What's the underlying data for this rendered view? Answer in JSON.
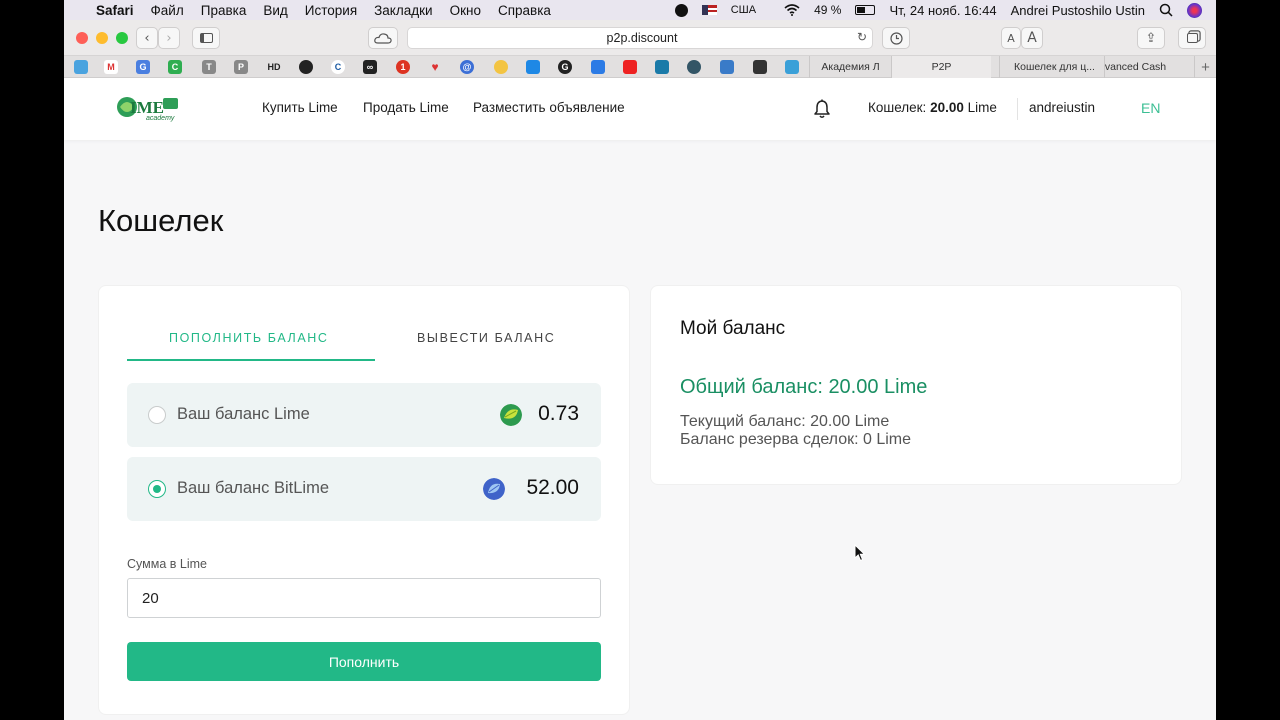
{
  "menubar": {
    "app": "Safari",
    "items": [
      "Файл",
      "Правка",
      "Вид",
      "История",
      "Закладки",
      "Окно",
      "Справка"
    ],
    "keyboard": "США",
    "battery": "49 %",
    "datetime": "Чт, 24 нояб.  16:44",
    "user": "Andrei Pustoshilo Ustin"
  },
  "browser": {
    "url": "p2p.discount",
    "font_small": "A",
    "font_large": "A",
    "tabs": [
      "Академия Л",
      "P2P",
      "Кошелек для ц...",
      "vanced Cash"
    ]
  },
  "header": {
    "nav": [
      "Купить Lime",
      "Продать Lime",
      "Разместить объявление"
    ],
    "wallet_prefix": "Кошелек: ",
    "wallet_amount": "20.00",
    "wallet_suffix": " Lime",
    "username": "andreiustin",
    "lang": "EN"
  },
  "page": {
    "title": "Кошелек"
  },
  "wallet_form": {
    "tab_deposit": "Пополнить баланс",
    "tab_withdraw": "Вывести баланс",
    "options": [
      {
        "label": "Ваш баланс Lime",
        "amount": "0.73",
        "selected": false,
        "icon": "lime-coin-icon"
      },
      {
        "label": "Ваш баланс BitLime",
        "amount": "52.00",
        "selected": true,
        "icon": "bitlime-coin-icon"
      }
    ],
    "amount_label": "Сумма в Lime",
    "amount_value": "20",
    "submit_label": "Пополнить"
  },
  "balance_card": {
    "title": "Мой баланс",
    "total": "Общий баланс: 20.00 Lime",
    "current": "Текущий баланс: 20.00 Lime",
    "reserve": "Баланс резерва сделок: 0 Lime"
  },
  "colors": {
    "accent": "#22b887",
    "accent_dark": "#1a8f63",
    "option_bg": "#eef4f4"
  }
}
